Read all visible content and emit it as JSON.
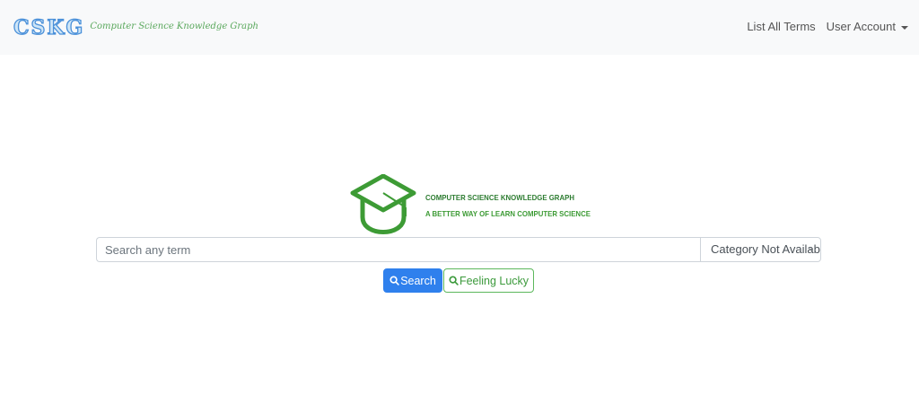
{
  "navbar": {
    "brand_logo": "CSKG",
    "brand_subtitle": "Computer Science Knowledge Graph",
    "links": {
      "list_terms": "List All Terms",
      "user_account": "User Account"
    }
  },
  "hero": {
    "icon": "graduation-cap-icon",
    "title": "COMPUTER SCIENCE KNOWLEDGE GRAPH",
    "tagline": "A BETTER WAY OF LEARN COMPUTER SCIENCE"
  },
  "search": {
    "placeholder": "Search any term",
    "value": "",
    "category_selected": "Category Not Available"
  },
  "buttons": {
    "search_label": "Search",
    "lucky_label": "Feeling Lucky"
  },
  "colors": {
    "primary": "#2f80ed",
    "green": "#3d9b35",
    "navbar_bg": "#f8f9fa"
  }
}
